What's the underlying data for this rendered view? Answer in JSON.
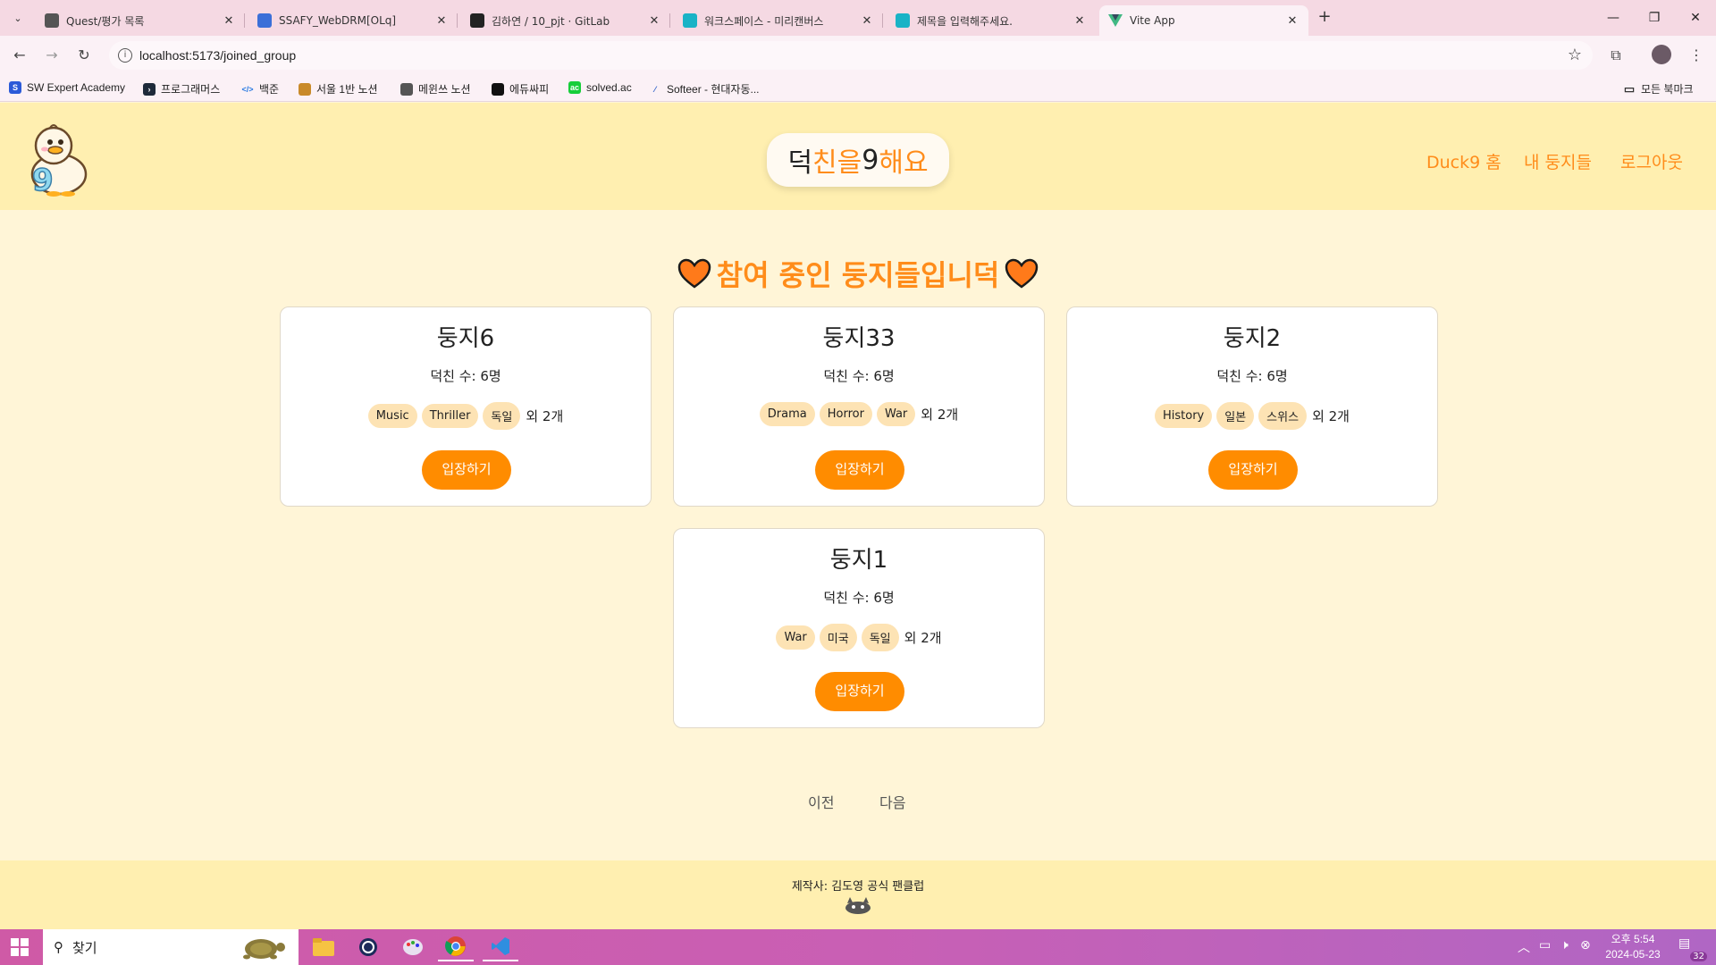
{
  "browser": {
    "tabs": [
      {
        "title": "Quest/평가 목록",
        "icon_color": "#555555",
        "active": false
      },
      {
        "title": "SSAFY_WebDRM[OLq]",
        "icon_color": "#3b6fd8",
        "active": false
      },
      {
        "title": "김하연 / 10_pjt · GitLab",
        "icon_color": "#222222",
        "active": false
      },
      {
        "title": "워크스페이스 - 미리캔버스",
        "icon_color": "#19b3c6",
        "active": false
      },
      {
        "title": "제목을 입력해주세요.",
        "icon_color": "#19b3c6",
        "active": false
      },
      {
        "title": "Vite App",
        "icon_color": "#41b883",
        "active": true
      }
    ],
    "url": "localhost:5173/joined_group",
    "bookmarks": [
      {
        "label": "SW Expert Academy",
        "icon_color": "#2c5bd8"
      },
      {
        "label": "프로그래머스",
        "icon_color": "#1e2a3a"
      },
      {
        "label": "백준",
        "icon_color": "#2a7ae2"
      },
      {
        "label": "서울 1반 노션",
        "icon_color": "#c98a2a"
      },
      {
        "label": "메윈쓰 노션",
        "icon_color": "#555555"
      },
      {
        "label": "에듀싸피",
        "icon_color": "#111111"
      },
      {
        "label": "solved.ac",
        "icon_color": "#17ce3a"
      },
      {
        "label": "Softeer - 현대자동...",
        "icon_color": "#2a5ec8"
      }
    ],
    "all_bookmarks": "모든 북마크"
  },
  "header": {
    "brand": {
      "p1": "덕",
      "p2": "친을",
      "p3": " 9",
      "p4": "해요"
    },
    "nav": {
      "home": "Duck9 홈",
      "my_nests": "내 둥지들",
      "logout": "로그아웃"
    }
  },
  "main": {
    "heading": "참여 중인 둥지들입니덕",
    "enter_label": "입장하기",
    "groups": [
      {
        "name": "둥지6",
        "members": "덕친 수: 6명",
        "tags": [
          "Music",
          "Thriller",
          "독일"
        ],
        "more": "외 2개"
      },
      {
        "name": "둥지33",
        "members": "덕친 수: 6명",
        "tags": [
          "Drama",
          "Horror",
          "War"
        ],
        "more": "외 2개"
      },
      {
        "name": "둥지2",
        "members": "덕친 수: 6명",
        "tags": [
          "History",
          "일본",
          "스위스"
        ],
        "more": "외 2개"
      },
      {
        "name": "둥지1",
        "members": "덕친 수: 6명",
        "tags": [
          "War",
          "미국",
          "독일"
        ],
        "more": "외 2개"
      }
    ],
    "pager": {
      "prev": "이전",
      "next": "다음"
    }
  },
  "footer": {
    "credit": "제작사: 김도영 공식 팬클럽"
  },
  "taskbar": {
    "search_placeholder": "찾기",
    "clock_time": "오후 5:54",
    "clock_date": "2024-05-23",
    "notification_count": "32"
  },
  "colors": {
    "accent": "#ff8c1a",
    "header_bg": "#ffefb0",
    "page_bg": "#fff5d7",
    "tag_bg": "#fde3b4"
  }
}
